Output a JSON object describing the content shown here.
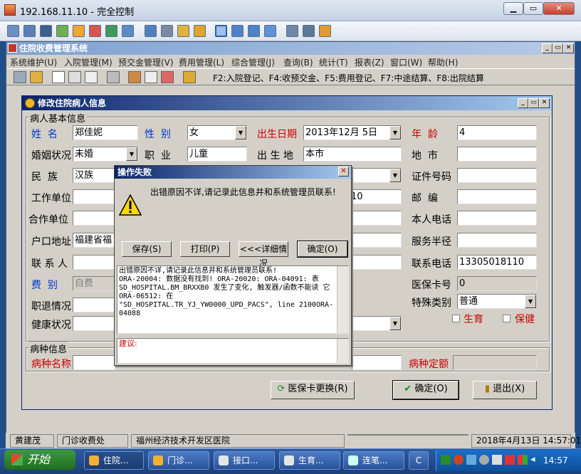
{
  "remote": {
    "title": "192.168.11.10 - 完全控制",
    "min": "▭",
    "restore": "▭",
    "close": "✕"
  },
  "app": {
    "title": "住院收费管理系统",
    "menu": [
      "系统维护(U)",
      "入院管理(M)",
      "预交金管理(V)",
      "费用管理(L)",
      "综合管理(J)",
      "查询(B)",
      "统计(T)",
      "报表(Z)",
      "窗口(W)",
      "帮助(H)"
    ],
    "shortcut_hint": "F2:入院登记、F4:收预交金、F5:费用登记、F7:中途结算、F8:出院结算"
  },
  "dialog": {
    "title": "修改住院病人信息",
    "basic_group": "病人基本信息",
    "disease_group": "病种信息",
    "fields": {
      "name_label": "姓  名",
      "name": "郑佳妮",
      "gender_label": "性  别",
      "gender": "女",
      "birth_label": "出生日期",
      "birth": "2013年12月 5日",
      "age_label": "年  龄",
      "age": "4",
      "marital_label": "婚姻状况",
      "marital": "未婚",
      "job_label": "职  业",
      "job": "儿童",
      "birthplace_label": "出 生 地",
      "birthplace": "本市",
      "address_label": "地  市",
      "nation_label": "民  族",
      "nation": "汉族",
      "idno_label": "证件号码",
      "work_label": "工作单位",
      "work_tail": "10",
      "postcode_label": "邮  编",
      "coop_label": "合作单位",
      "phone_label": "本人电话",
      "hukou_label": "户口地址",
      "hukou": "福建省福",
      "radius_label": "服务半径",
      "contact_label": "联 系 人",
      "contact_phone_label": "联系电话",
      "contact_phone": "13305018110",
      "fee_label": "费  别",
      "fee": "自费",
      "card_label": "医保卡号",
      "card": "0",
      "retire_label": "职退情况",
      "special_label": "特殊类别",
      "special": "普通",
      "health_label": "健康状况",
      "birth_check": "生育",
      "care_check": "保健",
      "disease_label": "病种名称",
      "disease_quota_label": "病种定额"
    },
    "btn_card": "医保卡更换(R)",
    "btn_ok": "确定(O)",
    "btn_exit": "退出(X)"
  },
  "error": {
    "title": "操作失败",
    "message": "出错原因不详,请记录此信息并和系统管理员联系!",
    "btn_save": "保存(S)",
    "btn_print": "打印(P)",
    "btn_detail": "<<<详细情况",
    "btn_ok": "确定(O)",
    "detail": "出错原因不详,请记录此信息并和系统管理员联系!\nORA-20004: 数据没有找到! ORA-20020: ORA-04091: 表 SD_HOSPITAL.BM_BRXXB0 发生了变化, 触发器/函数不能读 它ORA-06512: 在\n\"SD_HOSPITAL.TR_YJ_YW0000_UPD_PACS\", line 2100ORA-04088",
    "suggest_label": "建议:"
  },
  "status": [
    "黄建茂",
    "门诊收费处",
    "福州经济技术开发区医院",
    "",
    "2018年4月13日 14:57:01"
  ],
  "taskbar": {
    "start": "开始",
    "items": [
      "住院...",
      "门诊...",
      "接口...",
      "生育...",
      "连笔..."
    ],
    "clock": "14:57"
  }
}
